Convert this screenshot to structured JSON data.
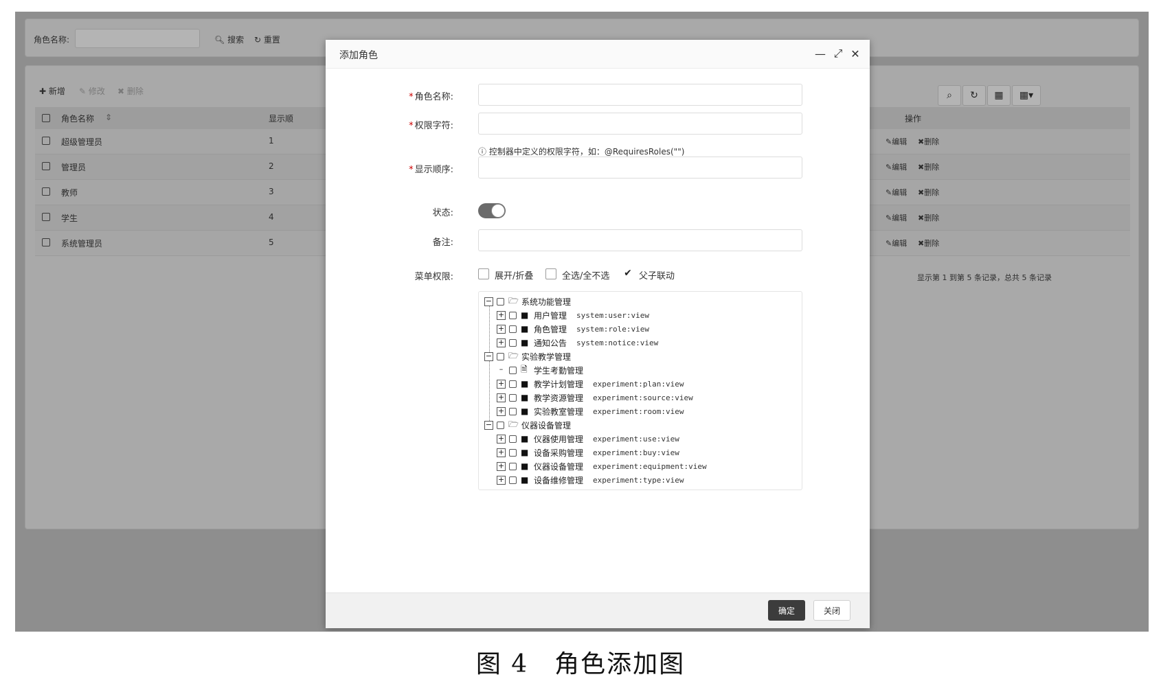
{
  "search": {
    "role_name_label": "角色名称:",
    "search_btn": "搜索",
    "reset_btn": "重置"
  },
  "toolbar": {
    "add": "新增",
    "edit": "修改",
    "delete": "删除"
  },
  "table": {
    "headers": {
      "name": "角色名称",
      "order": "显示顺",
      "actions": "操作"
    },
    "rows": [
      {
        "name": "超级管理员",
        "order": "1"
      },
      {
        "name": "管理员",
        "order": "2"
      },
      {
        "name": "教师",
        "order": "3"
      },
      {
        "name": "学生",
        "order": "4"
      },
      {
        "name": "系统管理员",
        "order": "5"
      }
    ],
    "edit_label": "编辑",
    "delete_label": "删除",
    "pagination": "显示第 1 到第 5 条记录，总共 5 条记录"
  },
  "icons": {
    "search": "search-icon",
    "refresh": "refresh-icon",
    "columns": "columns-icon",
    "grid": "grid-icon",
    "minimize": "minimize-icon",
    "maximize": "maximize-icon",
    "close": "close-icon",
    "info": "info-icon",
    "folder": "folder-icon",
    "file": "file-icon"
  },
  "modal": {
    "title": "添加角色",
    "fields": {
      "role_name": "角色名称:",
      "perm_key": "权限字符:",
      "perm_hint": "控制器中定义的权限字符，如：@RequiresRoles(\"\")",
      "sort_order": "显示顺序:",
      "status": "状态:",
      "remark": "备注:",
      "menu_perm": "菜单权限:"
    },
    "options": {
      "expand": "展开/折叠",
      "select_all": "全选/全不选",
      "linkage": "父子联动"
    },
    "confirm": "确定",
    "close": "关闭"
  },
  "tree": [
    {
      "label": "系统功能管理",
      "perm": "",
      "level": 0
    },
    {
      "label": "用户管理",
      "perm": "system:user:view",
      "level": 1
    },
    {
      "label": "角色管理",
      "perm": "system:role:view",
      "level": 1
    },
    {
      "label": "通知公告",
      "perm": "system:notice:view",
      "level": 1
    },
    {
      "label": "实验教学管理",
      "perm": "",
      "level": 0
    },
    {
      "label": "学生考勤管理",
      "perm": "",
      "level": 1
    },
    {
      "label": "教学计划管理",
      "perm": "experiment:plan:view",
      "level": 1
    },
    {
      "label": "教学资源管理",
      "perm": "experiment:source:view",
      "level": 1
    },
    {
      "label": "实验教室管理",
      "perm": "experiment:room:view",
      "level": 1
    },
    {
      "label": "仪器设备管理",
      "perm": "",
      "level": 0
    },
    {
      "label": "仪器使用管理",
      "perm": "experiment:use:view",
      "level": 1
    },
    {
      "label": "设备采购管理",
      "perm": "experiment:buy:view",
      "level": 1
    },
    {
      "label": "仪器设备管理",
      "perm": "experiment:equipment:view",
      "level": 1
    },
    {
      "label": "设备维修管理",
      "perm": "experiment:type:view",
      "level": 1
    }
  ],
  "caption": "图 4　角色添加图"
}
